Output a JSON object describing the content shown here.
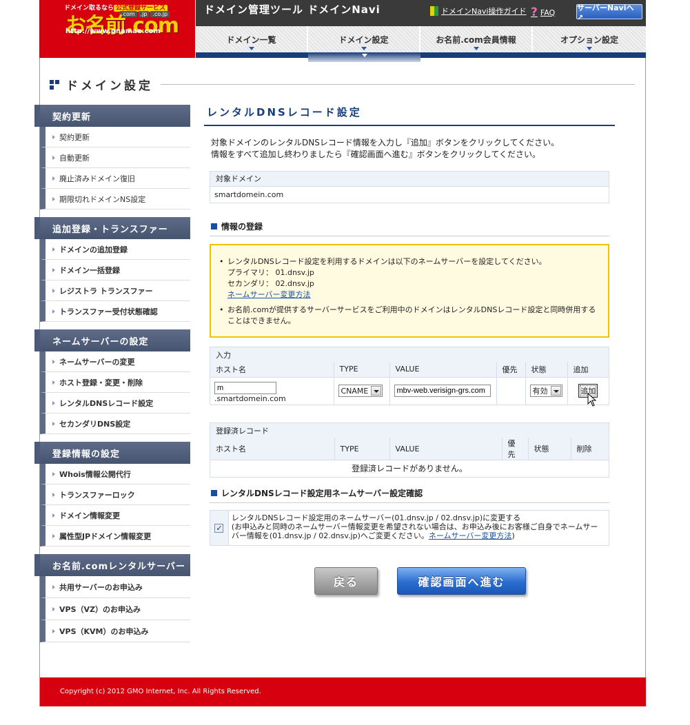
{
  "header": {
    "logo_tagline": "ドメイン取るなら",
    "logo_badge": "公式登録サービス",
    "logo_tlds": [
      ".com",
      ".jp",
      ".co.jp"
    ],
    "logo_brand": "お名前.com",
    "logo_url": "http://www.onamae.com",
    "tool_title": "ドメイン管理ツール ドメインNavi",
    "help_link": "ドメインNavi操作ガイド",
    "faq_link": "FAQ",
    "server_navi_button": "サーバーNaviへ ↗"
  },
  "nav": {
    "items": [
      {
        "label": "ドメイン一覧"
      },
      {
        "label": "ドメイン設定"
      },
      {
        "label": "お名前.com会員情報"
      },
      {
        "label": "オプション設定"
      }
    ],
    "active_index": 1
  },
  "page_title": "ドメイン設定",
  "sidebar": {
    "groups": [
      {
        "title": "契約更新",
        "items": [
          "契約更新",
          "自動更新",
          "廃止済みドメイン復旧",
          "期限切れドメインNS設定"
        ]
      },
      {
        "title": "追加登録・トランスファー",
        "items": [
          "ドメインの追加登録",
          "ドメイン一括登録",
          "レジストラ トランスファー",
          "トランスファー受付状態確認"
        ]
      },
      {
        "title": "ネームサーバーの設定",
        "items": [
          "ネームサーバーの変更",
          "ホスト登録・変更・削除",
          "レンタルDNSレコード設定",
          "セカンダリDNS設定"
        ]
      },
      {
        "title": "登録情報の設定",
        "items": [
          "Whois情報公開代行",
          "トランスファーロック",
          "ドメイン情報変更",
          "属性型JPドメイン情報変更"
        ]
      },
      {
        "title": "お名前.comレンタルサーバー",
        "items": [
          "共用サーバーのお申込み",
          "VPS（VZ）のお申込み",
          "VPS（KVM）のお申込み"
        ]
      }
    ]
  },
  "main": {
    "heading": "レンタルDNSレコード設定",
    "intro_line1": "対象ドメインのレンタルDNSレコード情報を入力し『追加』ボタンをクリックしてください。",
    "intro_line2": "情報をすべて追加し終わりましたら『確認画面へ進む』ボタンをクリックしてください。",
    "target_label": "対象ドメイン",
    "target_value": "smartdomein.com",
    "section_register": "情報の登録",
    "notice": {
      "item1": "レンタルDNSレコード設定を利用するドメインは以下のネームサーバーを設定してください。",
      "primary": "プライマリ： 01.dnsv.jp",
      "secondary": "セカンダリ： 02.dnsv.jp",
      "link": "ネームサーバー変更方法",
      "item2": "お名前.comが提供するサーバーサービスをご利用中のドメインはレンタルDNSレコード設定と同時併用することはできません。"
    },
    "input_table": {
      "caption": "入力",
      "headers": [
        "ホスト名",
        "TYPE",
        "VALUE",
        "優先",
        "状態",
        "追加"
      ],
      "host_value": "m",
      "host_suffix": ".smartdomein.com",
      "type_value": "CNAME",
      "value_value": "mbv-web.verisign-grs.com",
      "status_value": "有効",
      "add_button": "追加"
    },
    "registered_table": {
      "caption": "登録済レコード",
      "headers": [
        "ホスト名",
        "TYPE",
        "VALUE",
        "優先",
        "状態",
        "削除"
      ],
      "empty_message": "登録済レコードがありません。"
    },
    "section_confirm": "レンタルDNSレコード設定用ネームサーバー設定確認",
    "confirm": {
      "checked": true,
      "line1": "レンタルDNSレコード設定用のネームサーバー(01.dnsv.jp / 02.dnsv.jp)に変更する",
      "line2": "(お申込みと同時のネームサーバー情報変更を希望されない場合は、お申込み後にお客様ご自身でネームサーバー情報を(01.dnsv.jp / 02.dnsv.jp)へご変更ください。",
      "link": "ネームサーバー変更方法",
      "line2_end": ")"
    },
    "back_button": "戻る",
    "next_button": "確認画面へ進む"
  },
  "footer": {
    "copyright": "Copyright (c) 2012 GMO Internet, Inc. All Rights Reserved."
  },
  "colors": {
    "brand_red": "#d7000f",
    "nav_blue": "#163e7a",
    "sidebar_head": "#4c5a77",
    "notice_border": "#f2c200"
  }
}
